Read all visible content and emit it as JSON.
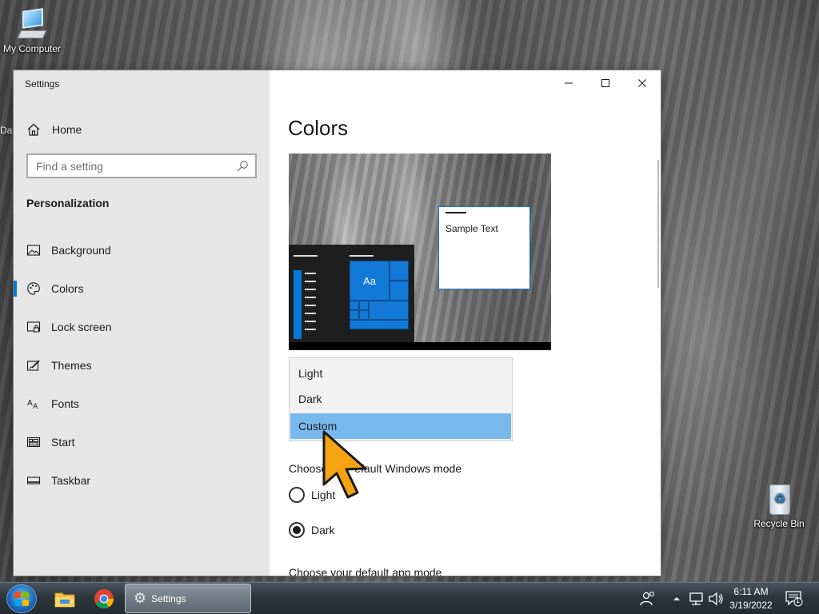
{
  "desktop": {
    "my_computer_label": "My Computer",
    "recycle_bin_label": "Recycle Bin",
    "partial_label": "Da"
  },
  "window": {
    "title": "Settings",
    "caption_buttons": [
      "minimize",
      "maximize",
      "close"
    ]
  },
  "sidebar": {
    "home_label": "Home",
    "search_placeholder": "Find a setting",
    "section_title": "Personalization",
    "items": [
      {
        "label": "Background",
        "icon": "picture-icon"
      },
      {
        "label": "Colors",
        "icon": "palette-icon",
        "selected": true
      },
      {
        "label": "Lock screen",
        "icon": "lock-screen-icon"
      },
      {
        "label": "Themes",
        "icon": "themes-icon"
      },
      {
        "label": "Fonts",
        "icon": "fonts-icon"
      },
      {
        "label": "Start",
        "icon": "start-icon"
      },
      {
        "label": "Taskbar",
        "icon": "taskbar-icon"
      }
    ]
  },
  "content": {
    "page_title": "Colors",
    "preview": {
      "tile_text": "Aa",
      "sample_text": "Sample Text"
    },
    "color_dropdown": {
      "options": [
        "Light",
        "Dark",
        "Custom"
      ],
      "selected": "Custom"
    },
    "windows_mode_label_left": "Choose",
    "windows_mode_label_right": "efault Windows mode",
    "windows_mode_options": [
      {
        "label": "Light",
        "checked": false
      },
      {
        "label": "Dark",
        "checked": true
      }
    ],
    "app_mode_label": "Choose your default app mode"
  },
  "taskbar": {
    "active_app_label": "Settings",
    "clock_time": "6:11 AM",
    "clock_date": "3/19/2022",
    "notification_count": "1"
  },
  "colors": {
    "accent": "#0078d7",
    "dropdown_highlight": "#77b9ec",
    "sidebar_bg": "#e6e6e6"
  }
}
